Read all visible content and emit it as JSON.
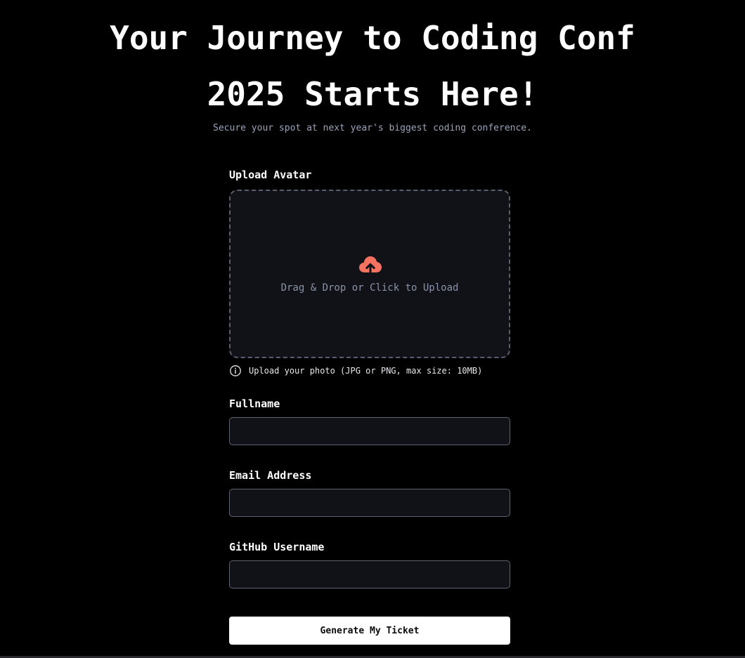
{
  "hero": {
    "title_line1": "Your Journey to Coding Conf",
    "title_line2": "2025 Starts Here!",
    "subtitle": "Secure your spot at next year's biggest coding conference."
  },
  "form": {
    "avatar": {
      "label": "Upload Avatar",
      "dropzone_text": "Drag & Drop or Click to Upload",
      "hint": "Upload your photo (JPG or PNG, max size: 10MB)",
      "icon": "upload-cloud-icon",
      "icon_color": "#f57261"
    },
    "fullname": {
      "label": "Fullname",
      "value": "",
      "placeholder": ""
    },
    "email": {
      "label": "Email Address",
      "value": "",
      "placeholder": ""
    },
    "github": {
      "label": "GitHub Username",
      "value": "",
      "placeholder": ""
    },
    "submit_label": "Generate My Ticket"
  },
  "colors": {
    "background": "#000000",
    "field_background": "#111217",
    "muted_text": "#9aa3b8",
    "accent": "#f57261"
  }
}
